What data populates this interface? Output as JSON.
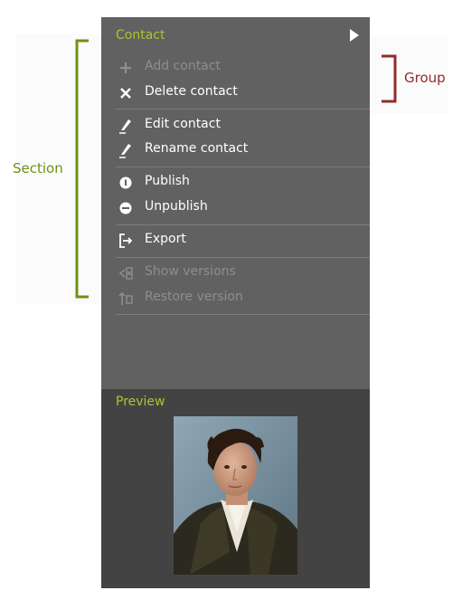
{
  "panel": {
    "title": "Contact",
    "items": [
      {
        "label": "Add contact",
        "icon": "plus-icon",
        "disabled": true
      },
      {
        "label": "Delete contact",
        "icon": "close-icon",
        "disabled": false
      },
      {
        "label": "Edit contact",
        "icon": "pen-icon",
        "disabled": false
      },
      {
        "label": "Rename contact",
        "icon": "pen-icon",
        "disabled": false
      },
      {
        "label": "Publish",
        "icon": "info-icon",
        "disabled": false
      },
      {
        "label": "Unpublish",
        "icon": "minus-circle-icon",
        "disabled": false
      },
      {
        "label": "Export",
        "icon": "export-icon",
        "disabled": false
      },
      {
        "label": "Show versions",
        "icon": "versions-icon",
        "disabled": true
      },
      {
        "label": "Restore version",
        "icon": "restore-icon",
        "disabled": true
      }
    ]
  },
  "preview": {
    "title": "Preview"
  },
  "annotations": {
    "section_label": "Section",
    "group_label": "Group"
  },
  "colors": {
    "panel_bg": "#616161",
    "preview_bg": "#434343",
    "accent_green": "#a8c632",
    "section_green": "#6f9114",
    "group_red": "#8f2d2d"
  }
}
